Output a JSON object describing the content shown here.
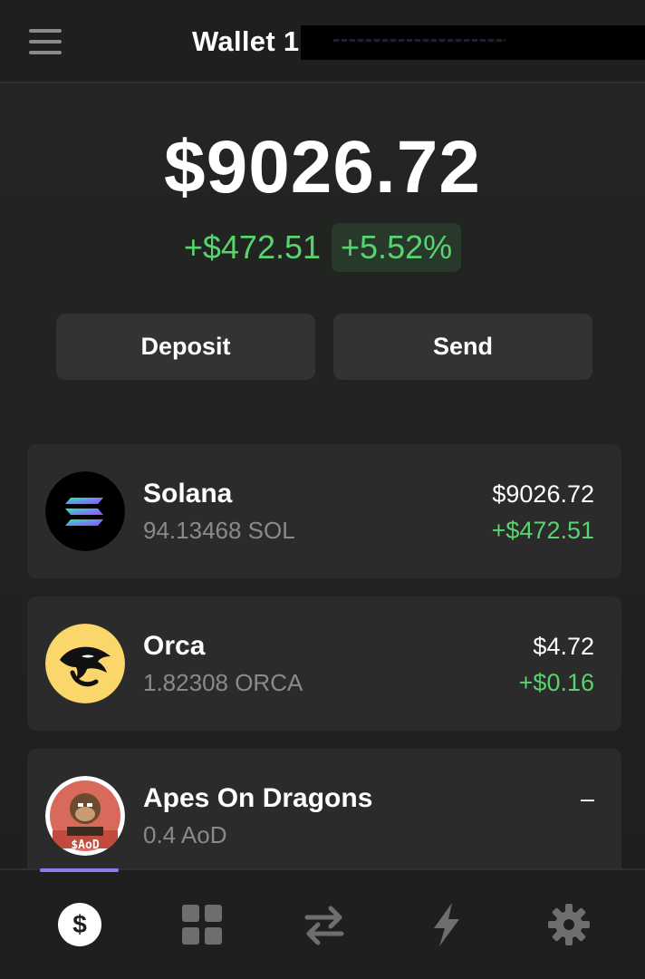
{
  "header": {
    "wallet_name": "Wallet 1",
    "menu_icon": "hamburger-menu-icon"
  },
  "balance": {
    "total": "$9026.72",
    "change_amount": "+$472.51",
    "change_percent": "+5.52%"
  },
  "actions": {
    "deposit_label": "Deposit",
    "send_label": "Send"
  },
  "tokens": [
    {
      "name": "Solana",
      "quantity": "94.13468 SOL",
      "usd_value": "$9026.72",
      "usd_change": "+$472.51",
      "icon": "solana-logo-icon"
    },
    {
      "name": "Orca",
      "quantity": "1.82308 ORCA",
      "usd_value": "$4.72",
      "usd_change": "+$0.16",
      "icon": "orca-logo-icon"
    },
    {
      "name": "Apes On Dragons",
      "quantity": "0.4 AoD",
      "usd_value": "–",
      "usd_change": "",
      "icon": "apes-on-dragons-logo-icon"
    }
  ],
  "nav": {
    "items": [
      "balances-icon",
      "collectibles-grid-icon",
      "swap-arrows-icon",
      "activity-bolt-icon",
      "settings-gear-icon"
    ],
    "active": "balances-icon"
  },
  "colors": {
    "positive": "#58d36e",
    "accent": "#8b7cf6",
    "card": "#2b2b2b",
    "button": "#333333"
  }
}
